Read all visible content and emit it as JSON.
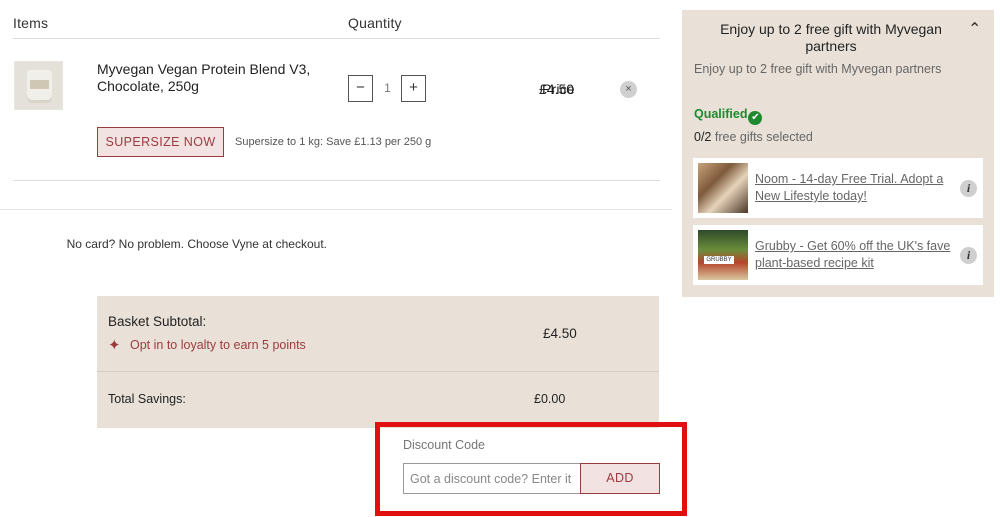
{
  "basket": {
    "headers": {
      "items": "Items",
      "quantity": "Quantity",
      "price": "Price"
    },
    "product": {
      "name": "Myvegan Vegan Protein Blend V3, Chocolate, 250g",
      "quantity": "1",
      "minus": "−",
      "plus": "+",
      "price": "£4.50",
      "remove_icon": "close-icon",
      "remove_glyph": "×"
    },
    "supersize": {
      "button_label": "SUPERSIZE NOW",
      "note": "Supersize to 1 kg: Save £1.13 per 250 g"
    },
    "vyne_note": "No card? No problem. Choose Vyne at checkout."
  },
  "summary": {
    "subtotal_label": "Basket Subtotal:",
    "subtotal_value": "£4.50",
    "loyalty_text": "Opt in to loyalty to earn 5 points",
    "loyalty_icon": "sparkle-icon",
    "savings_label": "Total Savings:",
    "savings_value": "£0.00"
  },
  "discount": {
    "label": "Discount Code",
    "placeholder": "Got a discount code? Enter it here",
    "value": "",
    "button_label": "ADD"
  },
  "gifts": {
    "title": "Enjoy up to 2 free gift with Myvegan partners",
    "subtitle": "Enjoy up to 2 free gift with Myvegan partners",
    "qualified_label": "Qualified",
    "selected_count": "0/2",
    "selected_text": "free gifts selected",
    "items": [
      {
        "text": "Noom - 14-day Free Trial. Adopt a New Lifestyle today!"
      },
      {
        "text": "Grubby - Get 60% off the UK's fave plant-based recipe kit"
      }
    ]
  },
  "colors": {
    "accent": "#9b3b3f",
    "panel_bg": "#e9e1d7",
    "qualified_green": "#1d8a2d",
    "highlight_red": "#e01010"
  }
}
